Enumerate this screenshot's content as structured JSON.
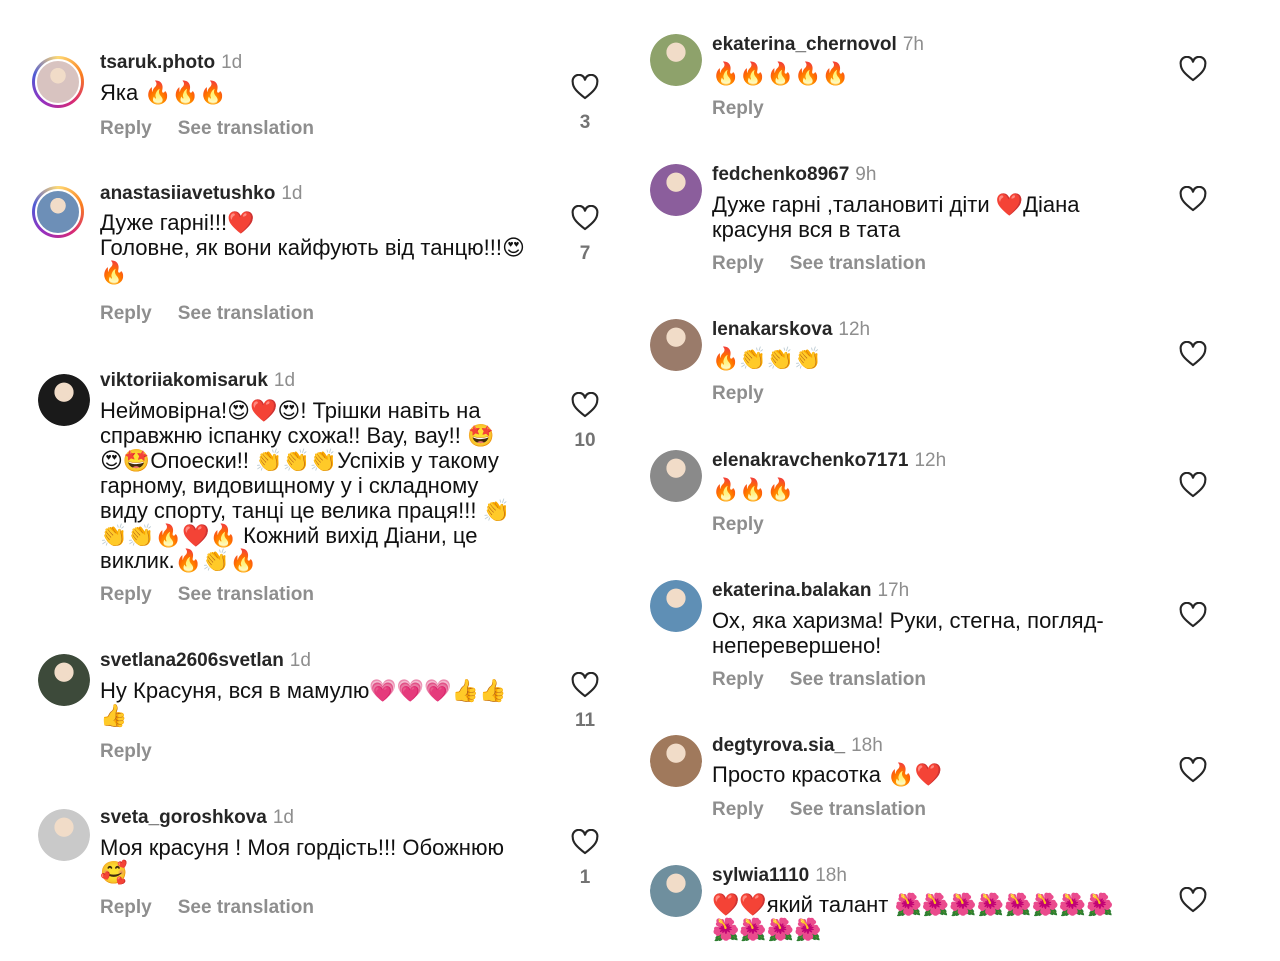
{
  "left": [
    {
      "user": "tsaruk.photo",
      "time": "1d",
      "text": "Яка 🔥🔥🔥",
      "reply": "Reply",
      "translate": "See translation",
      "likes": "3",
      "avatar": {
        "ring": true,
        "bg": "#d8c3c0"
      }
    },
    {
      "user": "anastasiiavetushko",
      "time": "1d",
      "text": "Дуже гарні!!!❤️\nГоловне, як вони кайфують від танцю!!!😍\n🔥",
      "reply": "Reply",
      "translate": "See translation",
      "likes": "7",
      "avatar": {
        "ring": true,
        "bg": "#6d8fb7"
      }
    },
    {
      "user": "viktoriiakomisaruk",
      "time": "1d",
      "text": "Неймовірна!😍❤️😍! Трішки навіть на\nсправжню іспанку схожа!! Вау, вау!! 🤩\n😍🤩Опоески!! 👏👏👏Успіхів у такому\nгарному, видовищному у і складному\nвиду спорту, танці це велика праця!!! 👏\n👏👏🔥❤️🔥 Кожний вихід Діани, це\nвиклик.🔥👏🔥",
      "reply": "Reply",
      "translate": "See translation",
      "likes": "10",
      "avatar": {
        "ring": false,
        "bg": "#1a1a1a"
      }
    },
    {
      "user": "svetlana2606svetlan",
      "time": "1d",
      "text": "Ну Красуня, вся в мамулю💗💗💗👍👍\n👍",
      "reply": "Reply",
      "translate": "",
      "likes": "11",
      "avatar": {
        "ring": false,
        "bg": "#3d4a3a"
      }
    },
    {
      "user": "sveta_goroshkova",
      "time": "1d",
      "text": "Моя красуня ! Моя гордість!!! Обожнюю\n🥰",
      "reply": "Reply",
      "translate": "See translation",
      "likes": "1",
      "avatar": {
        "ring": false,
        "bg": "#c9c9c9"
      }
    }
  ],
  "right": [
    {
      "user": "ekaterina_chernovol",
      "time": "7h",
      "text": "🔥🔥🔥🔥🔥",
      "reply": "Reply",
      "translate": "",
      "likes": "",
      "avatar": {
        "ring": false,
        "bg": "#8ea26b"
      }
    },
    {
      "user": "fedchenko8967",
      "time": "9h",
      "text": "Дуже гарні ,талановиті діти ❤️Діана\nкрасуня вся в тата",
      "reply": "Reply",
      "translate": "See translation",
      "likes": "",
      "avatar": {
        "ring": false,
        "bg": "#8b5e9c"
      }
    },
    {
      "user": "lenakarskova",
      "time": "12h",
      "text": "🔥👏👏👏",
      "reply": "Reply",
      "translate": "",
      "likes": "",
      "avatar": {
        "ring": false,
        "bg": "#9a7b6a"
      }
    },
    {
      "user": "elenakravchenko7171",
      "time": "12h",
      "text": "🔥🔥🔥",
      "reply": "Reply",
      "translate": "",
      "likes": "",
      "avatar": {
        "ring": false,
        "bg": "#8a8a8a"
      }
    },
    {
      "user": "ekaterina.balakan",
      "time": "17h",
      "text": "Ох, яка харизма! Руки, стегна, погляд-\nнеперевершено!",
      "reply": "Reply",
      "translate": "See translation",
      "likes": "",
      "avatar": {
        "ring": false,
        "bg": "#5f8fb5"
      }
    },
    {
      "user": "degtyrova.sia_",
      "time": "18h",
      "text": "Просто красотка 🔥❤️",
      "reply": "Reply",
      "translate": "See translation",
      "likes": "",
      "avatar": {
        "ring": false,
        "bg": "#a0795c"
      }
    },
    {
      "user": "sylwia1110",
      "time": "18h",
      "text": "❤️❤️який талант 🌺🌺🌺🌺🌺🌺🌺🌺\n🌺🌺🌺🌺",
      "reply": "",
      "translate": "",
      "likes": "",
      "avatar": {
        "ring": false,
        "bg": "#6f8f9e"
      }
    }
  ]
}
